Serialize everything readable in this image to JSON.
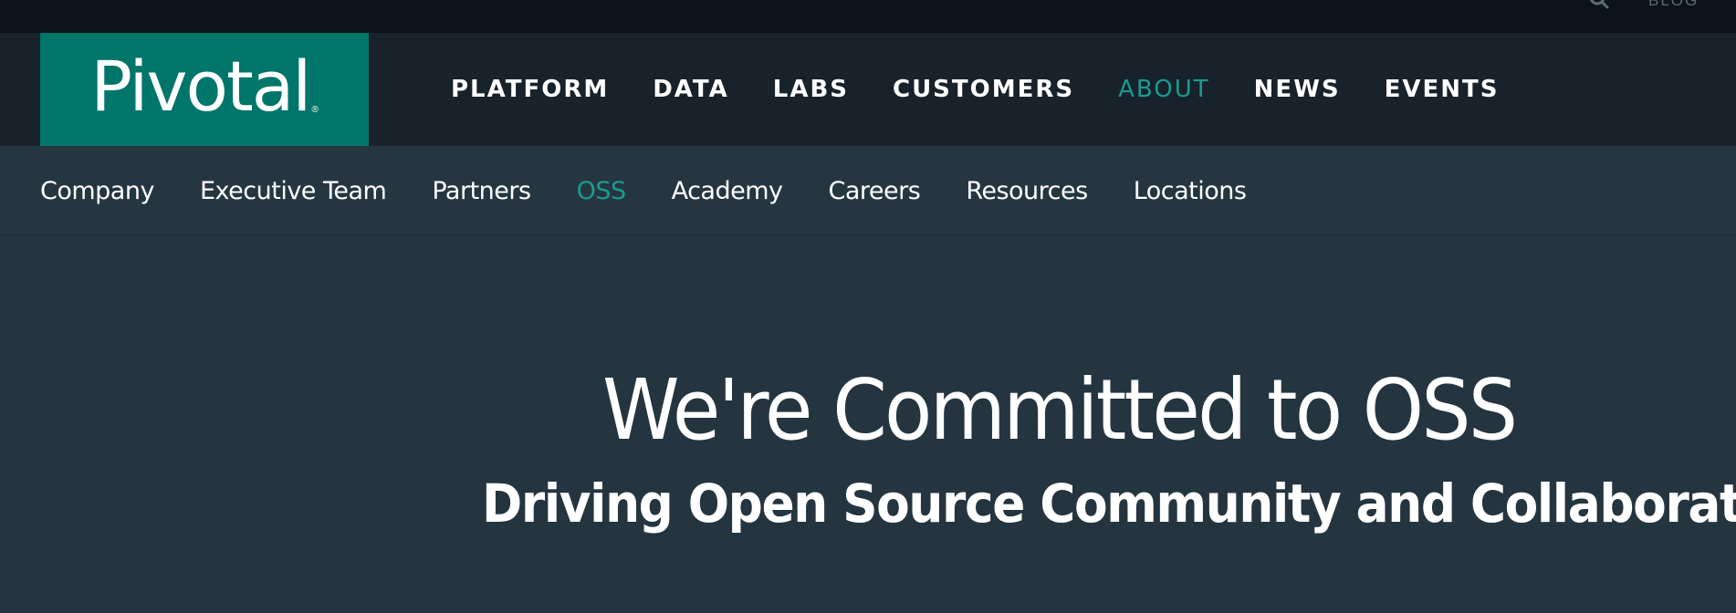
{
  "utility": {
    "search_icon": "search-icon",
    "blog_label": "BLOG"
  },
  "brand": {
    "logo_text": "Pivotal",
    "logo_mark": "®",
    "brand_color": "#00756a",
    "accent_color": "#1a9b8f"
  },
  "main_nav": {
    "items": [
      {
        "label": "PLATFORM"
      },
      {
        "label": "DATA"
      },
      {
        "label": "LABS"
      },
      {
        "label": "CUSTOMERS"
      },
      {
        "label": "ABOUT",
        "active": true
      },
      {
        "label": "NEWS"
      },
      {
        "label": "EVENTS"
      }
    ]
  },
  "sub_nav": {
    "items": [
      {
        "label": "Company"
      },
      {
        "label": "Executive Team"
      },
      {
        "label": "Partners"
      },
      {
        "label": "OSS",
        "active": true
      },
      {
        "label": "Academy"
      },
      {
        "label": "Careers"
      },
      {
        "label": "Resources"
      },
      {
        "label": "Locations"
      }
    ]
  },
  "hero": {
    "title": "We're Committed to OSS",
    "subtitle": "Driving Open Source Community and Collaboration"
  }
}
